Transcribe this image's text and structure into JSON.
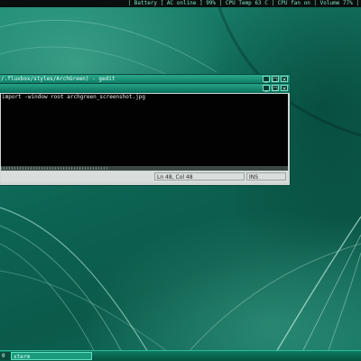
{
  "statusbar": {
    "text": "| Battery [ AC online ] 99% | CPU Temp 63 C | CPU fan on | Volume 77% |"
  },
  "window_back": {
    "title": "/.fluxbox/styles/ArchGreen) - gedit"
  },
  "window_front": {
    "terminal_lines": [
      "import -window root archgreen_screenshot.jpg"
    ],
    "status_position": "Ln 48, Col 48",
    "status_mode": "INS"
  },
  "window_buttons": {
    "minimize": "_",
    "maximize": "□",
    "close": "×"
  },
  "taskbar": {
    "workspace": "0",
    "tasks": [
      {
        "label": "xterm"
      }
    ]
  }
}
